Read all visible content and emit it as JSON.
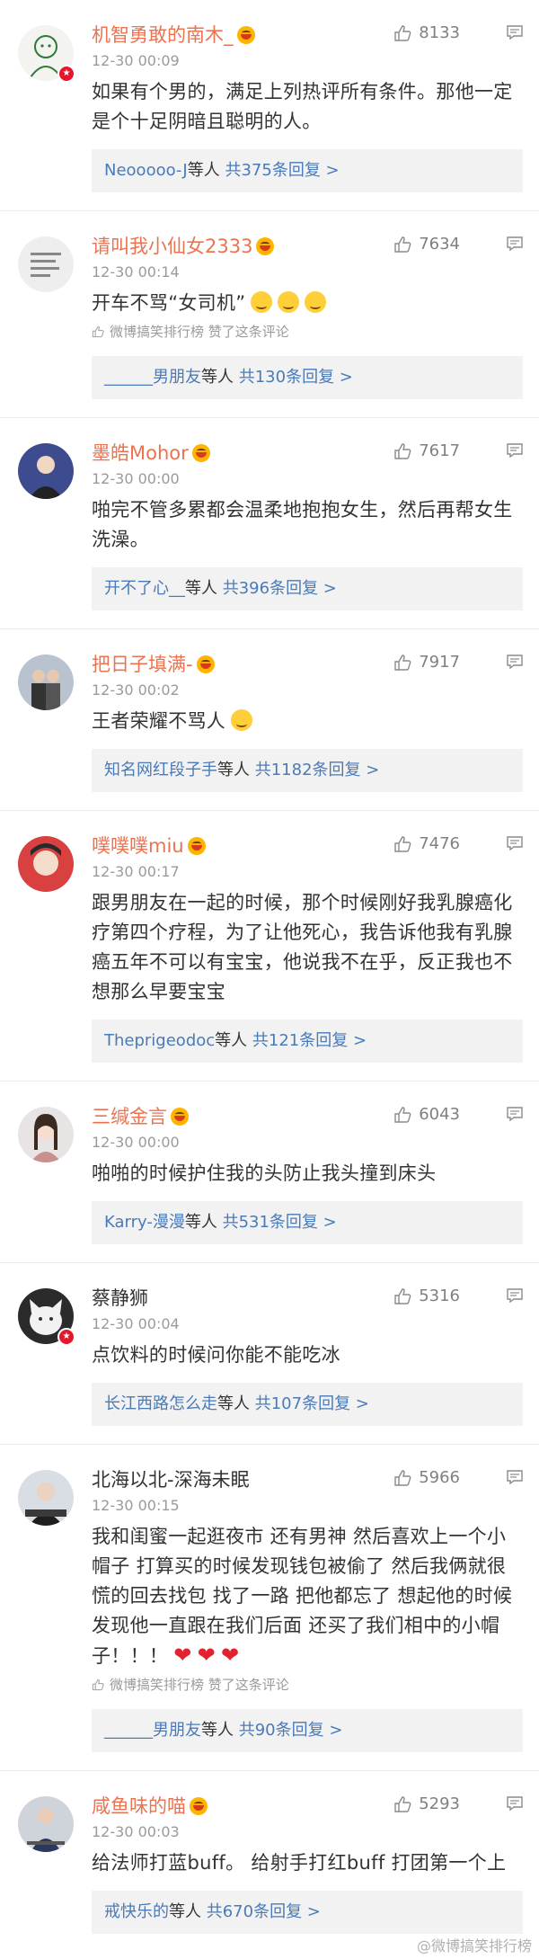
{
  "comments": [
    {
      "user": "机智勇敢的南木_",
      "time": "12-30 00:09",
      "likes": "8133",
      "text": "如果有个男的，满足上列热评所有条件。那他一定是个十足阴暗且聪明的人。",
      "reply_name": "Neooooo-J",
      "reply_mid": "等人 ",
      "reply_count": "共375条回复 >"
    },
    {
      "user": "请叫我小仙女2333",
      "time": "12-30 00:14",
      "likes": "7634",
      "text": "开车不骂“女司机”",
      "fav": "微博搞笑排行榜 赞了这条评论",
      "reply_name": "______男朋友",
      "reply_mid": "等人 ",
      "reply_count": "共130条回复 >"
    },
    {
      "user": "墨皓Mohor",
      "time": "12-30 00:00",
      "likes": "7617",
      "text": "啪完不管多累都会温柔地抱抱女生，然后再帮女生洗澡。",
      "reply_name": "开不了心__",
      "reply_mid": "等人 ",
      "reply_count": "共396条回复 >"
    },
    {
      "user": "把日子填满-",
      "time": "12-30 00:02",
      "likes": "7917",
      "text": "王者荣耀不骂人",
      "reply_name": "知名网红段子手",
      "reply_mid": "等人 ",
      "reply_count": "共1182条回复 >"
    },
    {
      "user": "噗噗噗miu",
      "time": "12-30 00:17",
      "likes": "7476",
      "text": "跟男朋友在一起的时候，那个时候刚好我乳腺癌化疗第四个疗程，为了让他死心，我告诉他我有乳腺癌五年不可以有宝宝，他说我不在乎，反正我也不想那么早要宝宝",
      "reply_name": "Theprigeodoc",
      "reply_mid": "等人 ",
      "reply_count": "共121条回复 >"
    },
    {
      "user": "三缄金言",
      "time": "12-30 00:00",
      "likes": "6043",
      "text": "啪啪的时候护住我的头防止我头撞到床头",
      "reply_name": "Karry-漫漫",
      "reply_mid": "等人 ",
      "reply_count": "共531条回复 >"
    },
    {
      "user": "蔡静狮",
      "time": "12-30 00:04",
      "likes": "5316",
      "text": "点饮料的时候问你能不能吃冰",
      "reply_name": "长江西路怎么走",
      "reply_mid": "等人 ",
      "reply_count": "共107条回复 >"
    },
    {
      "user": "北海以北-深海未眠",
      "time": "12-30 00:15",
      "likes": "5966",
      "text": "我和闺蜜一起逛夜市 还有男神 然后喜欢上一个小帽子 打算买的时候发现钱包被偷了 然后我俩就很慌的回去找包 找了一路 把他都忘了 想起他的时候 发现他一直跟在我们后面 还买了我们相中的小帽子！！！",
      "fav": "微博搞笑排行榜 赞了这条评论",
      "reply_name": "______男朋友",
      "reply_mid": "等人 ",
      "reply_count": "共90条回复 >"
    },
    {
      "user": "咸鱼味的喵",
      "time": "12-30 00:03",
      "likes": "5293",
      "text": "给法师打蓝buff。 给射手打红buff 打团第一个上",
      "reply_name": "戒快乐的",
      "reply_mid": "等人 ",
      "reply_count": "共670条回复 >"
    }
  ],
  "watermark": "@微博搞笑排行榜",
  "icons": {
    "like": "thumbs-up-icon",
    "more": "comment-bubble-icon",
    "fav": "thumbs-up-small-icon"
  },
  "colors": {
    "username": "#eb7350",
    "link": "#4a7ab8",
    "meta": "#9a9a9a",
    "reply_bg": "#f2f2f2"
  }
}
